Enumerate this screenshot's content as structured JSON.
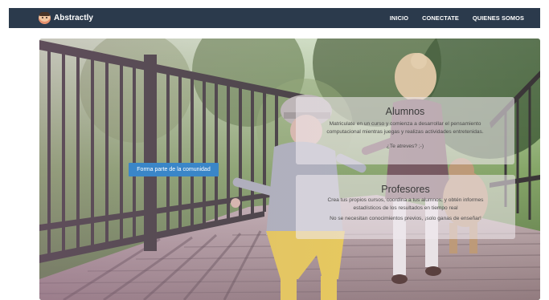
{
  "brand": {
    "name": "Abstractly"
  },
  "nav": {
    "links": [
      "INICIO",
      "CONECTATE",
      "QUIENES SOMOS"
    ]
  },
  "hero": {
    "cta_label": "Forma parte de la comunidad"
  },
  "cards": {
    "alumnos": {
      "title": "Alumnos",
      "desc_line1": "Matriculate en un curso y comienza a desarrollar el pensamiento",
      "desc_line2": "computacional mientras juegas y realizas actividades entretenidas.",
      "note": "¿Te atreves? ;-)"
    },
    "profesores": {
      "title": "Profesores",
      "desc_line1": "Crea tus propios cursos, coordina a tus alumnos, y obtén informes",
      "desc_line2": "estadísticos de los resultados en tiempo real",
      "note": "No se necesitan conocimientos previos, ¡solo ganas de enseñar!"
    }
  },
  "colors": {
    "navbar": "#2b3a4c",
    "cta": "#3a86c8"
  }
}
